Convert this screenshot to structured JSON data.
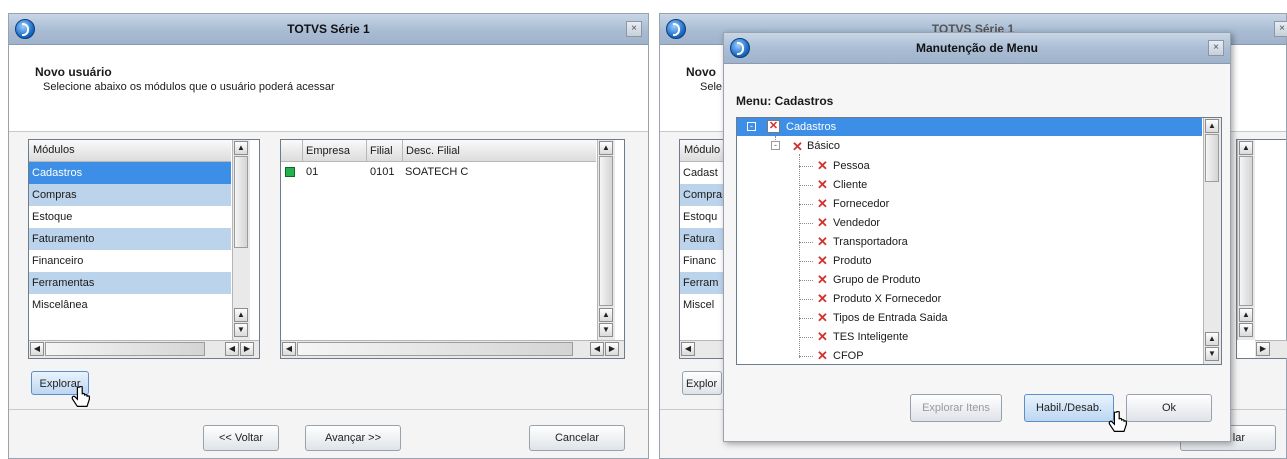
{
  "wizard": {
    "title": "TOTVS Série 1",
    "header_title": "Novo usuário",
    "header_subtitle": "Selecione abaixo os módulos que o usuário poderá acessar",
    "modules_header": "Módulos",
    "modules": [
      "Cadastros",
      "Compras",
      "Estoque",
      "Faturamento",
      "Financeiro",
      "Ferramentas",
      "Miscelânea"
    ],
    "branch_columns": [
      "Empresa",
      "Filial",
      "Desc. Filial"
    ],
    "branch_rows": [
      {
        "empresa": "01",
        "filial": "0101",
        "desc": "SOATECH C"
      }
    ],
    "explore_button": "Explorar",
    "back_button": "<< Voltar",
    "next_button": "Avançar >>",
    "cancel_button": "Cancelar"
  },
  "bg_window": {
    "title": "TOTVS Série 1",
    "header_title_partial": "Novo",
    "header_subtitle_partial": "Sele",
    "modules_header_partial": "Módulo",
    "modules_partial": [
      "Cadast",
      "Compra",
      "Estoqu",
      "Fatura",
      "Financ",
      "Ferram",
      "Miscel"
    ],
    "explore_partial": "Explor",
    "cancel_partial": "lar"
  },
  "menu_dialog": {
    "title": "Manutenção de Menu",
    "menu_label": "Menu: Cadastros",
    "root": "Cadastros",
    "group": "Básico",
    "items": [
      "Pessoa",
      "Cliente",
      "Fornecedor",
      "Vendedor",
      "Transportadora",
      "Produto",
      "Grupo de Produto",
      "Produto X Fornecedor",
      "Tipos de Entrada Saida",
      "TES Inteligente",
      "CFOP"
    ],
    "explore_items_button": "Explorar Itens",
    "toggle_button": "Habil./Desab.",
    "ok_button": "Ok"
  },
  "colors": {
    "selection": "#3d8ee6",
    "alt_row": "#bcd3ec",
    "disabled_x": "#d0332d",
    "status_green": "#22b14c"
  }
}
